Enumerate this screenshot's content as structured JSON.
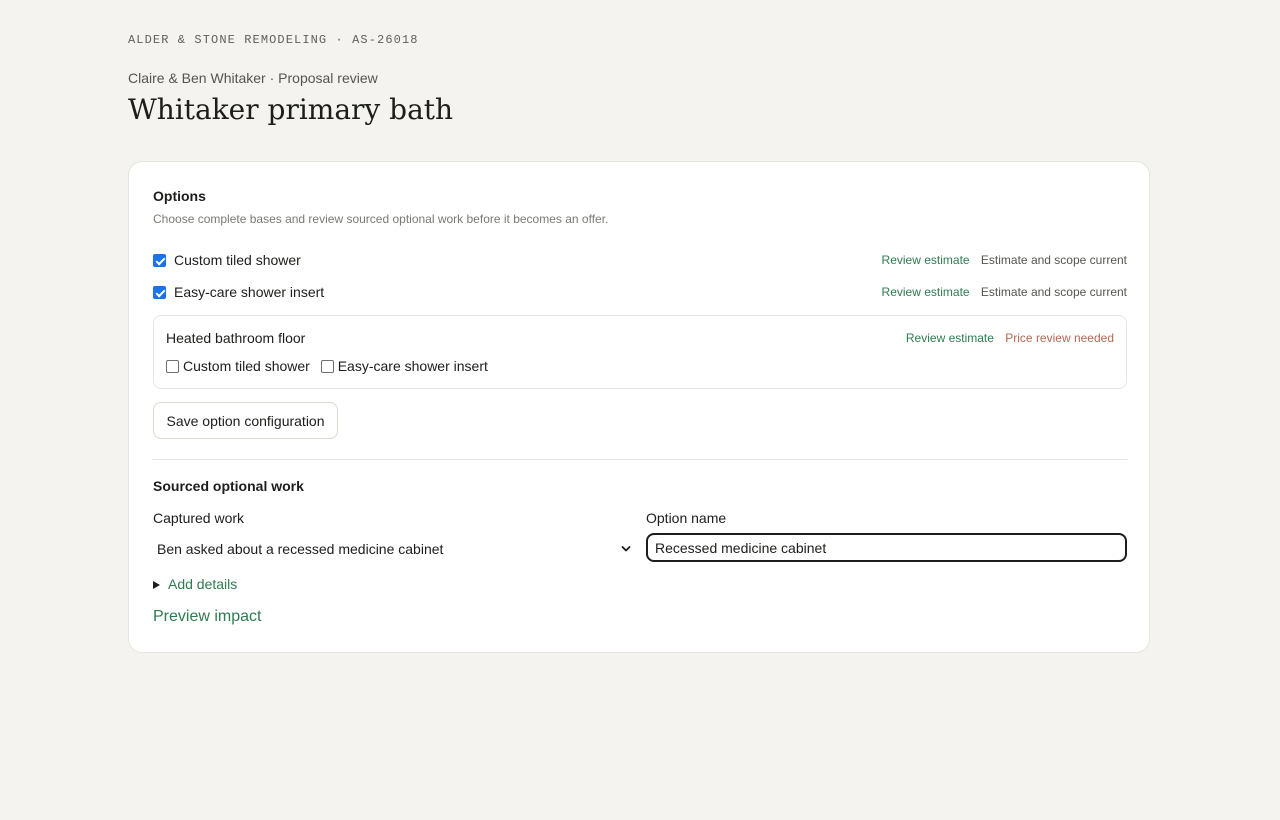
{
  "header": {
    "eyebrow": "ALDER & STONE REMODELING · AS-26018",
    "subtitle": "Claire & Ben Whitaker · Proposal review",
    "title": "Whitaker primary bath"
  },
  "options": {
    "heading": "Options",
    "description": "Choose complete bases and review sourced optional work before it becomes an offer.",
    "bases": [
      {
        "label": "Custom tiled shower",
        "checked": true,
        "review_label": "Review estimate",
        "status": "Estimate and scope current"
      },
      {
        "label": "Easy-care shower insert",
        "checked": true,
        "review_label": "Review estimate",
        "status": "Estimate and scope current"
      }
    ],
    "addon": {
      "title": "Heated bathroom floor",
      "review_label": "Review estimate",
      "status": "Price review needed",
      "applies_to": [
        {
          "label": "Custom tiled shower",
          "checked": false
        },
        {
          "label": "Easy-care shower insert",
          "checked": false
        }
      ]
    },
    "save_label": "Save option configuration"
  },
  "sourced": {
    "heading": "Sourced optional work",
    "captured_label": "Captured work",
    "captured_value": "Ben asked about a recessed medicine cabinet",
    "option_name_label": "Option name",
    "option_name_value": "Recessed medicine cabinet",
    "add_details_label": "Add details",
    "preview_label": "Preview impact"
  },
  "colors": {
    "background": "#f4f3ef",
    "card": "#ffffff",
    "link_green": "#2e7b51",
    "warning": "#b06a52",
    "checkbox_blue": "#1a73e8"
  }
}
